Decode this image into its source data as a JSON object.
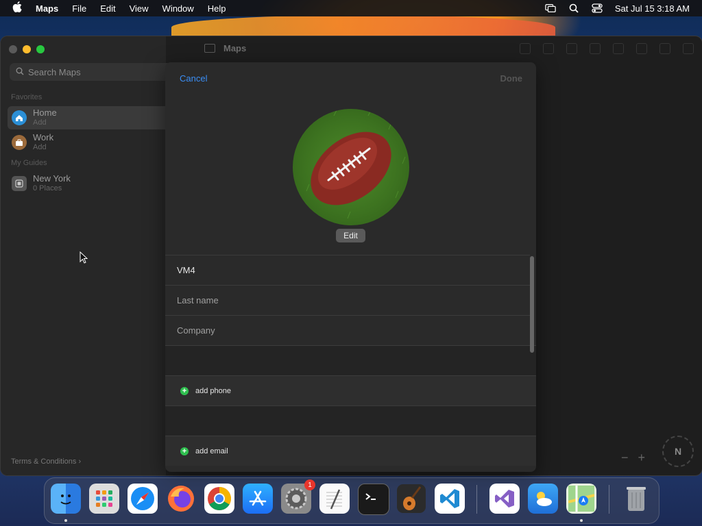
{
  "menubar": {
    "app_name": "Maps",
    "items": [
      "File",
      "Edit",
      "View",
      "Window",
      "Help"
    ],
    "datetime": "Sat Jul 15  3:18 AM"
  },
  "window": {
    "title": "Maps"
  },
  "sidebar": {
    "search_placeholder": "Search Maps",
    "favorites_label": "Favorites",
    "favorites": [
      {
        "title": "Home",
        "subtitle": "Add",
        "icon": "house-icon"
      },
      {
        "title": "Work",
        "subtitle": "Add",
        "icon": "briefcase-icon"
      }
    ],
    "guides_label": "My Guides",
    "guides": [
      {
        "title": "New York",
        "subtitle": "0 Places",
        "icon": "guide-icon"
      }
    ],
    "terms": "Terms & Conditions"
  },
  "map_controls": {
    "zoom_out": "−",
    "zoom_in": "+",
    "compass": "N"
  },
  "contact_sheet": {
    "cancel": "Cancel",
    "done": "Done",
    "edit_photo": "Edit",
    "first_name_value": "VM4",
    "last_name_placeholder": "Last name",
    "company_placeholder": "Company",
    "add_phone": "add phone",
    "add_email": "add email"
  },
  "dock": {
    "apps": [
      {
        "name": "Finder",
        "icon": "finder-icon",
        "running": true
      },
      {
        "name": "Launchpad",
        "icon": "launchpad-icon",
        "running": false
      },
      {
        "name": "Safari",
        "icon": "safari-icon",
        "running": false
      },
      {
        "name": "Firefox",
        "icon": "firefox-icon",
        "running": false
      },
      {
        "name": "Chrome",
        "icon": "chrome-icon",
        "running": false
      },
      {
        "name": "App Store",
        "icon": "app-store-icon",
        "running": false
      },
      {
        "name": "System Settings",
        "icon": "settings-icon",
        "running": false,
        "badge": "1"
      },
      {
        "name": "TextEdit",
        "icon": "textedit-icon",
        "running": false
      },
      {
        "name": "Terminal",
        "icon": "terminal-icon",
        "running": false
      },
      {
        "name": "GarageBand",
        "icon": "garageband-icon",
        "running": false
      },
      {
        "name": "VS Code",
        "icon": "vscode-icon",
        "running": false
      },
      {
        "name": "Visual Studio",
        "icon": "visual-studio-icon",
        "running": false
      },
      {
        "name": "Weather",
        "icon": "weather-icon",
        "running": false
      },
      {
        "name": "Maps",
        "icon": "maps-icon",
        "running": true
      },
      {
        "name": "Trash",
        "icon": "trash-icon",
        "running": false
      }
    ],
    "colors": {
      "finder": "#2a8cf0",
      "safari": "#1a8ef5",
      "chrome": "#ffffff",
      "appstore": "#1c7ef5",
      "vscode": "#ffffff",
      "weather": "#3a8ee8",
      "maps": "#ffffff"
    }
  },
  "colors": {
    "accent": "#3b8ef5",
    "add_green": "#2fbf4f",
    "badge_red": "#e8352c"
  }
}
